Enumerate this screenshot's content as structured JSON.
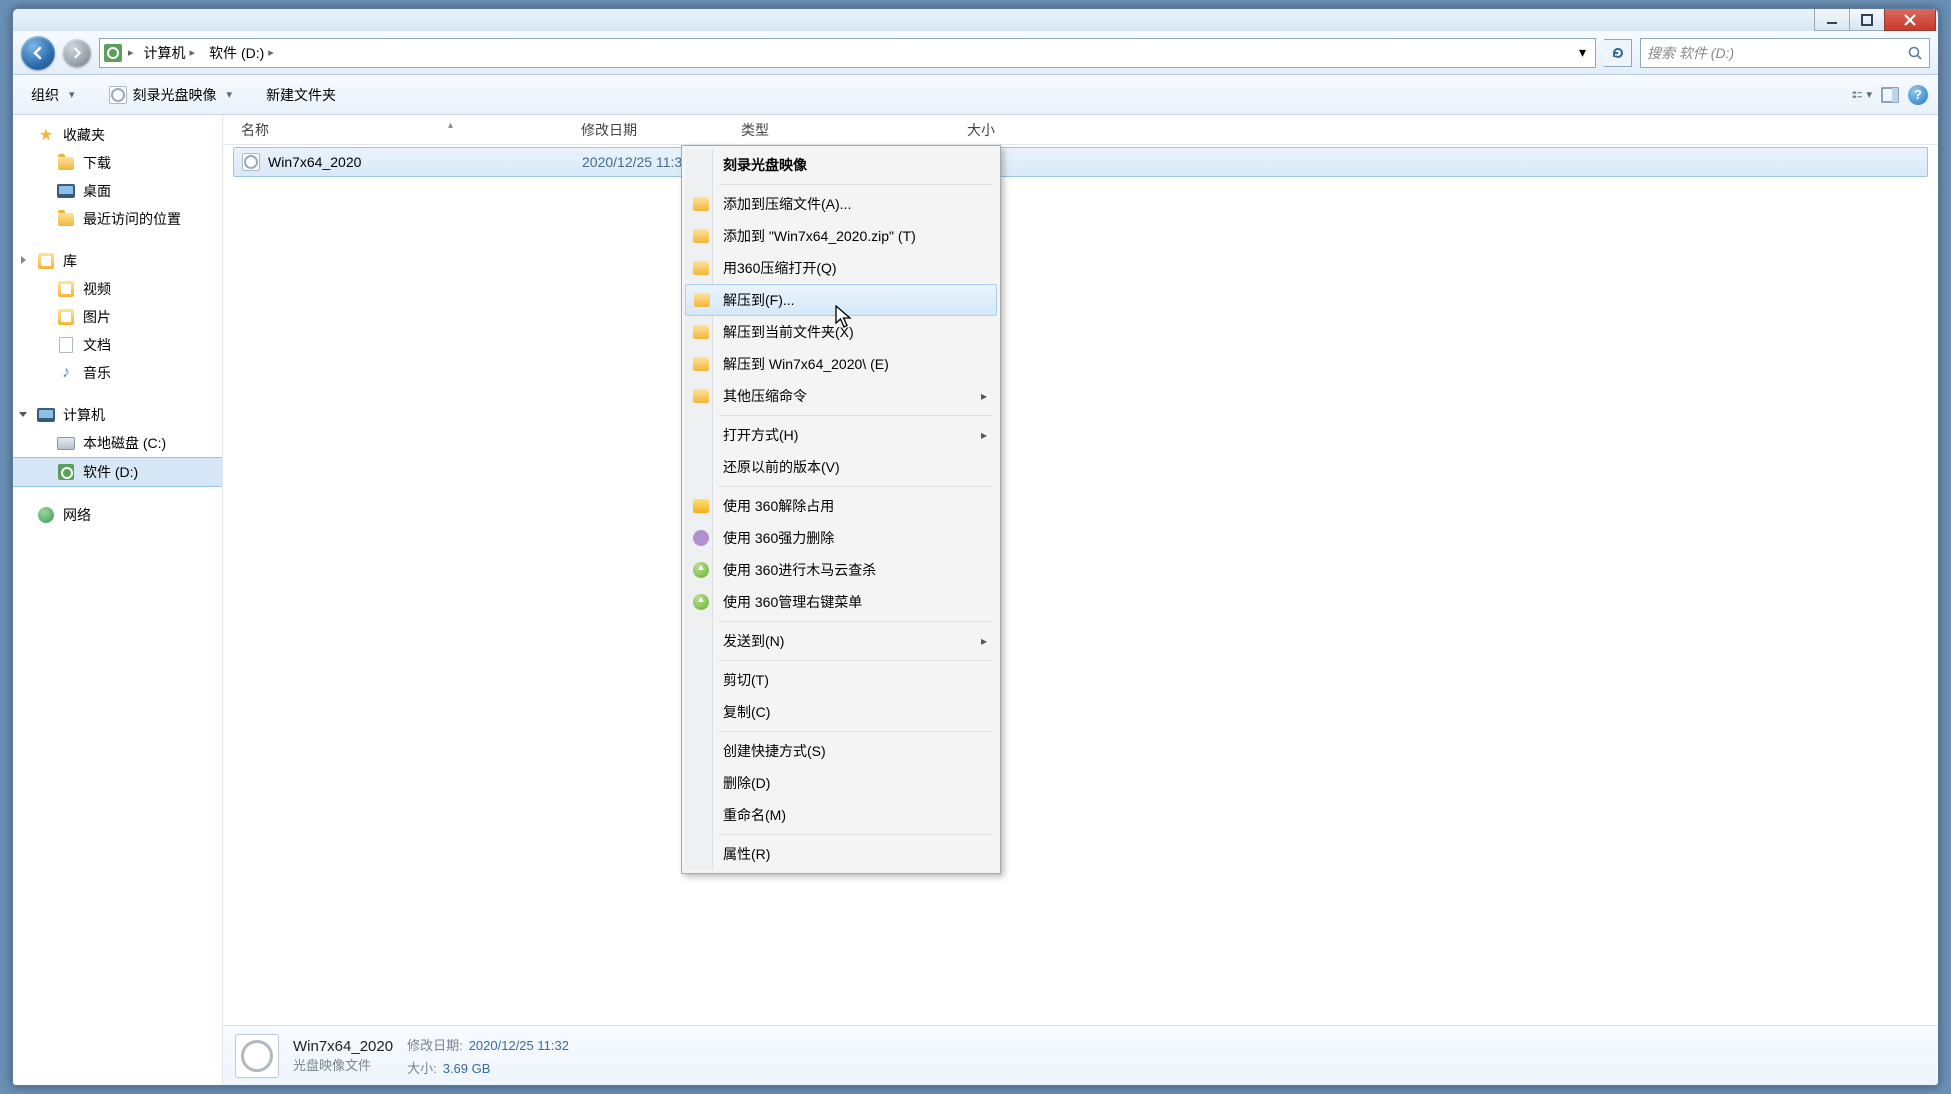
{
  "breadcrumb": {
    "part1": "计算机",
    "part2": "软件 (D:)"
  },
  "search": {
    "placeholder": "搜索 软件 (D:)"
  },
  "toolbar": {
    "organize": "组织",
    "burn": "刻录光盘映像",
    "newfolder": "新建文件夹"
  },
  "sidebar": {
    "favorites": {
      "head": "收藏夹",
      "downloads": "下载",
      "desktop": "桌面",
      "recent": "最近访问的位置"
    },
    "libraries": {
      "head": "库",
      "videos": "视频",
      "pictures": "图片",
      "documents": "文档",
      "music": "音乐"
    },
    "computer": {
      "head": "计算机",
      "c": "本地磁盘 (C:)",
      "d": "软件 (D:)"
    },
    "network": {
      "head": "网络"
    }
  },
  "columns": {
    "name": "名称",
    "date": "修改日期",
    "type": "类型",
    "size": "大小"
  },
  "file": {
    "name": "Win7x64_2020",
    "date": "2020/12/25 11:32",
    "type": "光盘映像文件",
    "size": "3,874,126 ..."
  },
  "context": {
    "burn": "刻录光盘映像",
    "addArchive": "添加到压缩文件(A)...",
    "addZip": "添加到 \"Win7x64_2020.zip\" (T)",
    "openWith360zip": "用360压缩打开(Q)",
    "extractTo": "解压到(F)...",
    "extractHere": "解压到当前文件夹(X)",
    "extractNamed": "解压到 Win7x64_2020\\ (E)",
    "otherZip": "其他压缩命令",
    "openWith": "打开方式(H)",
    "restore": "还原以前的版本(V)",
    "unlock360": "使用 360解除占用",
    "forceDel360": "使用 360强力删除",
    "trojan360": "使用 360进行木马云查杀",
    "menu360": "使用 360管理右键菜单",
    "sendTo": "发送到(N)",
    "cut": "剪切(T)",
    "copy": "复制(C)",
    "shortcut": "创建快捷方式(S)",
    "delete": "删除(D)",
    "rename": "重命名(M)",
    "properties": "属性(R)"
  },
  "details": {
    "name": "Win7x64_2020",
    "typeLabel": "光盘映像文件",
    "dateLabel": "修改日期:",
    "dateVal": "2020/12/25 11:32",
    "sizeLabel": "大小:",
    "sizeVal": "3.69 GB"
  }
}
